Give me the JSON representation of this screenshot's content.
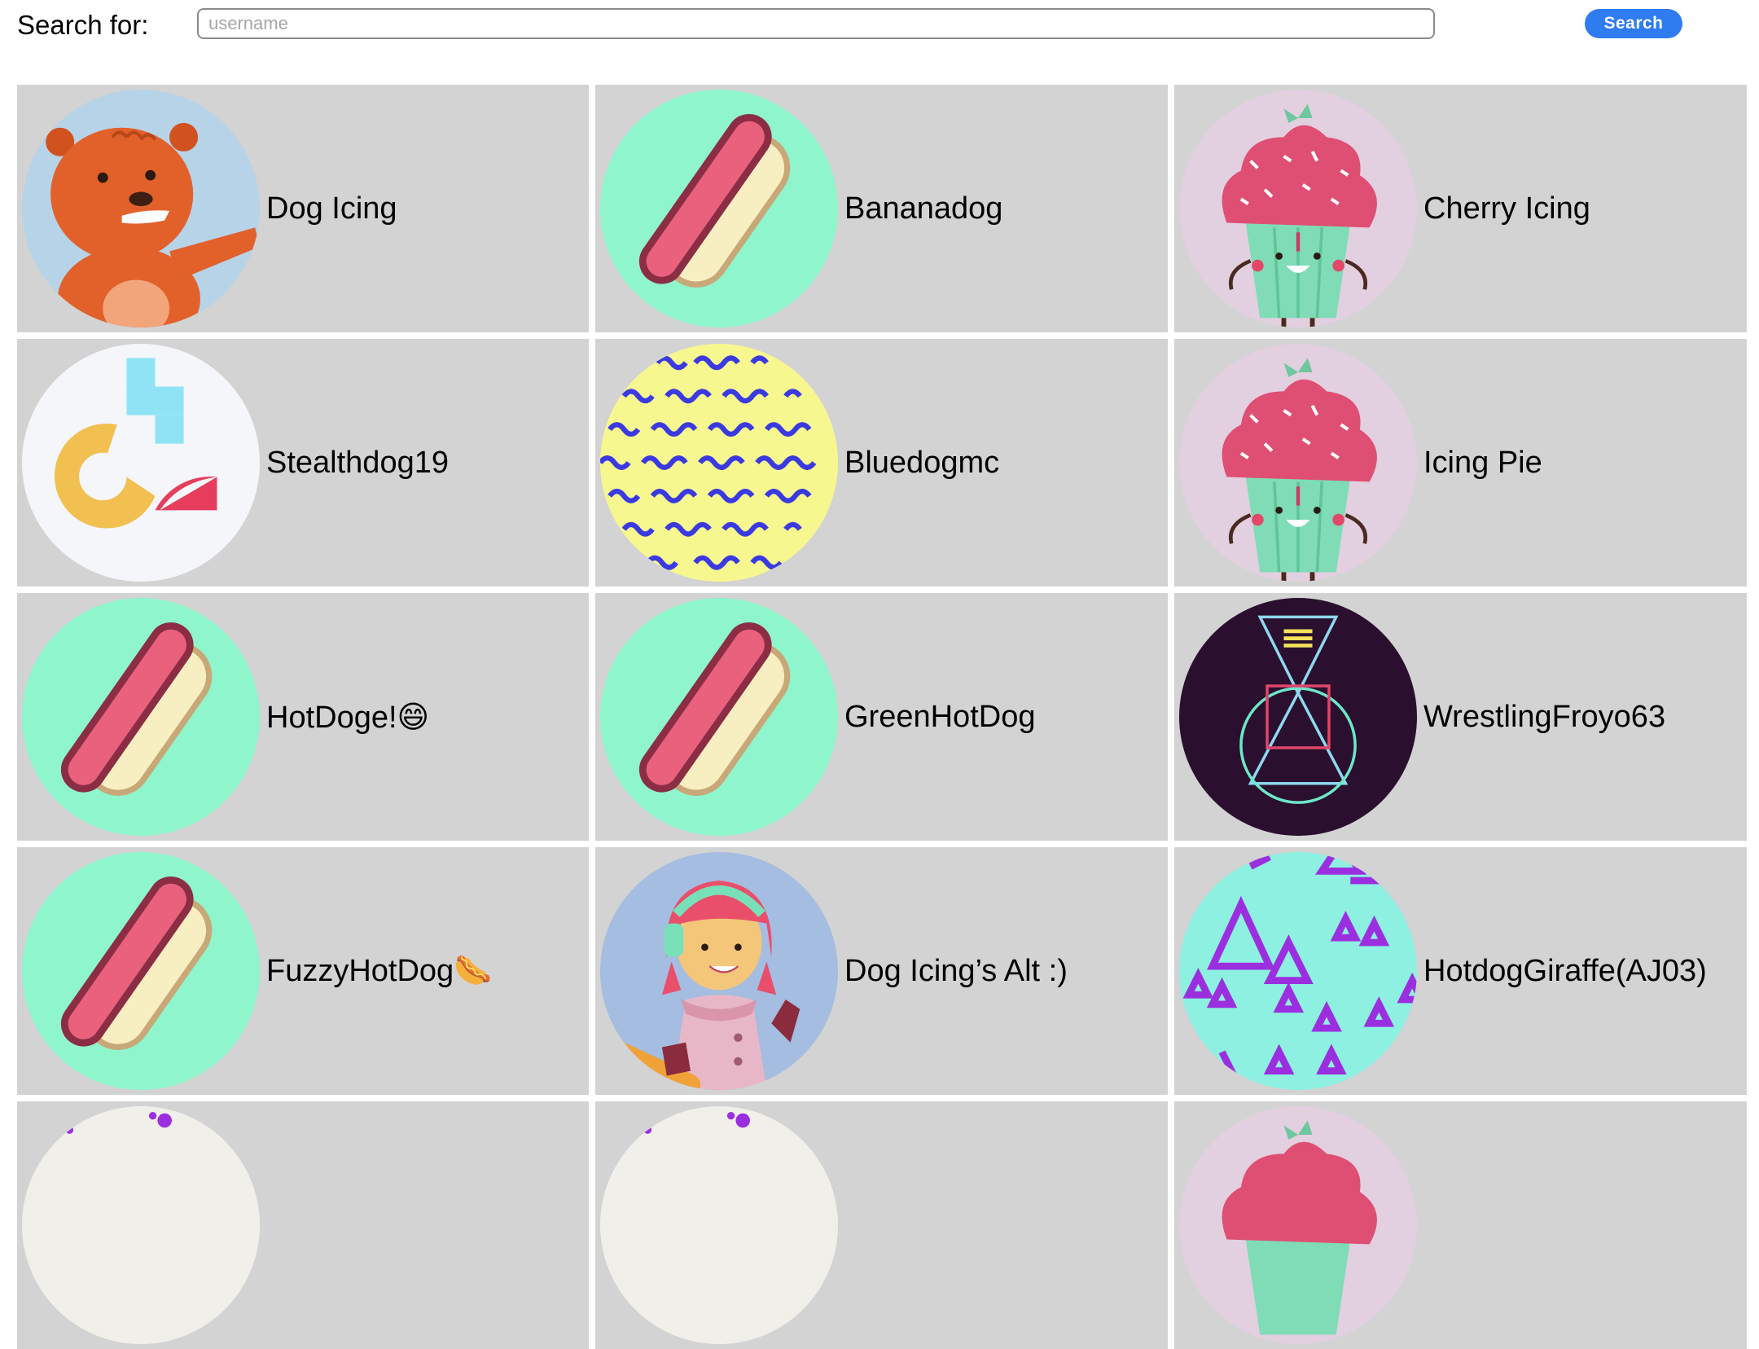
{
  "search": {
    "label": "Search for:",
    "placeholder": "username",
    "value": "",
    "button_label": "Search"
  },
  "users": [
    {
      "name": "Dog Icing",
      "avatar": "bear-avatar-icon"
    },
    {
      "name": "Bananadog",
      "avatar": "hotdog-avatar-icon"
    },
    {
      "name": "Cherry Icing",
      "avatar": "cupcake-avatar-icon"
    },
    {
      "name": "Stealthdog19",
      "avatar": "geometric-shapes-avatar-icon"
    },
    {
      "name": "Bluedogmc",
      "avatar": "wavy-pattern-avatar-icon"
    },
    {
      "name": "Icing Pie",
      "avatar": "cupcake-avatar-icon"
    },
    {
      "name": "HotDoge!😄",
      "avatar": "hotdog-avatar-icon"
    },
    {
      "name": "GreenHotDog",
      "avatar": "hotdog-avatar-icon"
    },
    {
      "name": "WrestlingFroyo63",
      "avatar": "triangle-circle-avatar-icon"
    },
    {
      "name": "FuzzyHotDog🌭",
      "avatar": "hotdog-avatar-icon"
    },
    {
      "name": "Dog Icing’s Alt :)",
      "avatar": "girl-headphones-avatar-icon"
    },
    {
      "name": "HotdogGiraffe(AJ03)",
      "avatar": "triangle-pattern-avatar-icon"
    },
    {
      "name": "",
      "avatar": "dotted-avatar-icon"
    },
    {
      "name": "",
      "avatar": "dotted-avatar-icon"
    },
    {
      "name": "",
      "avatar": "cupcake-avatar-icon"
    }
  ],
  "colors": {
    "card_background": "#d3d3d3",
    "button_blue": "#2f7bf0"
  }
}
